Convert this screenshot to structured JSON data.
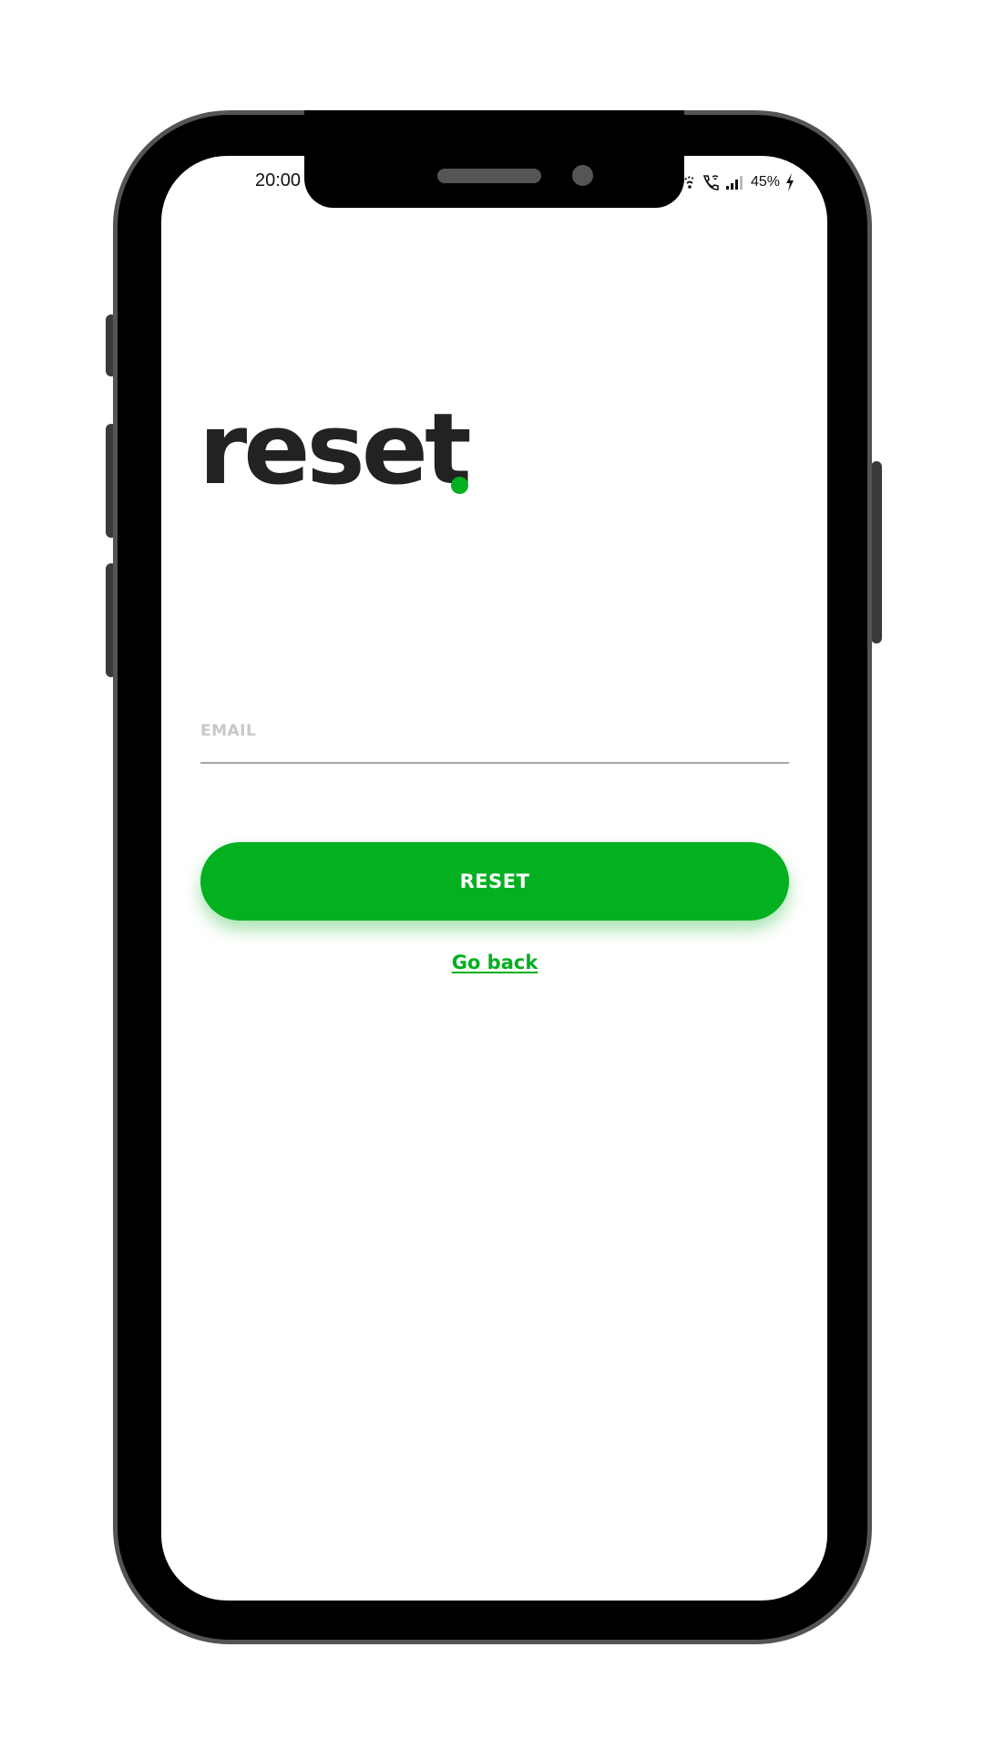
{
  "status_bar": {
    "time": "20:00",
    "battery": "45%",
    "icons": [
      "wifi-icon",
      "wifi-call-icon",
      "signal-icon",
      "charging-icon"
    ]
  },
  "page": {
    "title": "reset",
    "title_dot": ".",
    "email": {
      "placeholder": "EMAIL",
      "value": ""
    },
    "reset_label": "RESET",
    "go_back_label": "Go back"
  },
  "colors": {
    "accent": "#03b020",
    "title_text": "#222222",
    "placeholder": "#c8c8c8",
    "underline": "#a6a6a6",
    "frame": "#000000",
    "frame_border": "#545454"
  }
}
